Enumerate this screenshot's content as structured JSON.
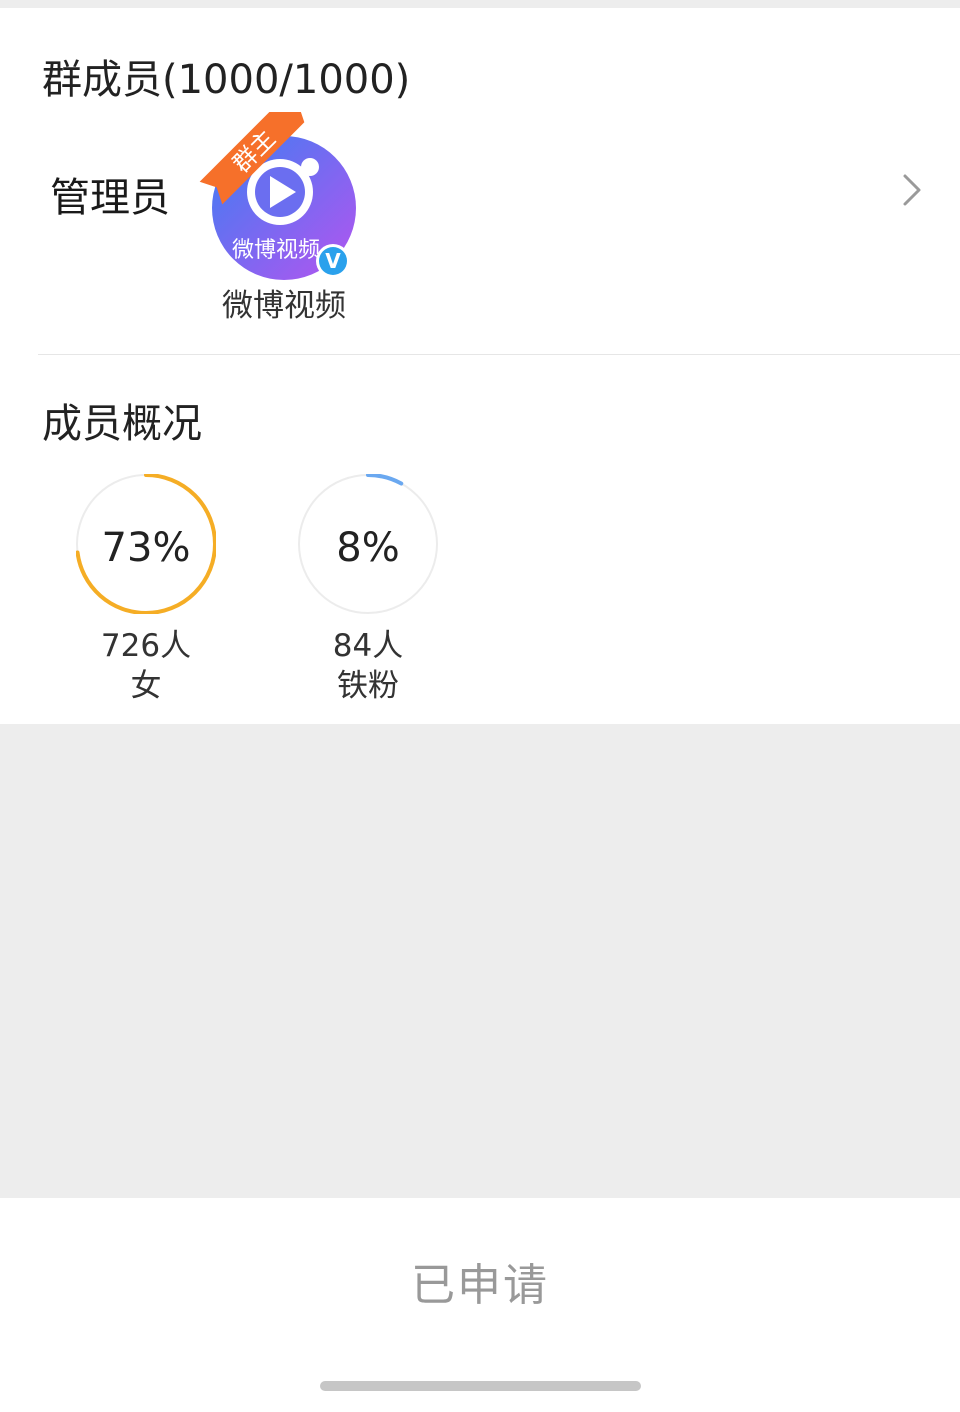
{
  "members_section": {
    "title": "群成员(1000/1000)"
  },
  "admin": {
    "label": "管理员",
    "owner_ribbon": "群主",
    "avatar_caption": "微博视频",
    "name": "微博视频",
    "verified_mark": "V",
    "icons": [
      "play-icon",
      "verified-badge-icon",
      "chevron-right-icon"
    ],
    "colors": {
      "avatar_gradient_start": "#3d7ef2",
      "avatar_gradient_end": "#b554f0",
      "ribbon": "#f6702a",
      "verified": "#2aa1ec"
    }
  },
  "overview": {
    "title": "成员概况",
    "stats": [
      {
        "percent_label": "73%",
        "percent": 0.73,
        "count": "726人",
        "label": "女",
        "color": "#f5ad25"
      },
      {
        "percent_label": "8%",
        "percent": 0.08,
        "count": "84人",
        "label": "铁粉",
        "color": "#6aa8f0"
      }
    ]
  },
  "footer": {
    "button_label": "已申请"
  }
}
